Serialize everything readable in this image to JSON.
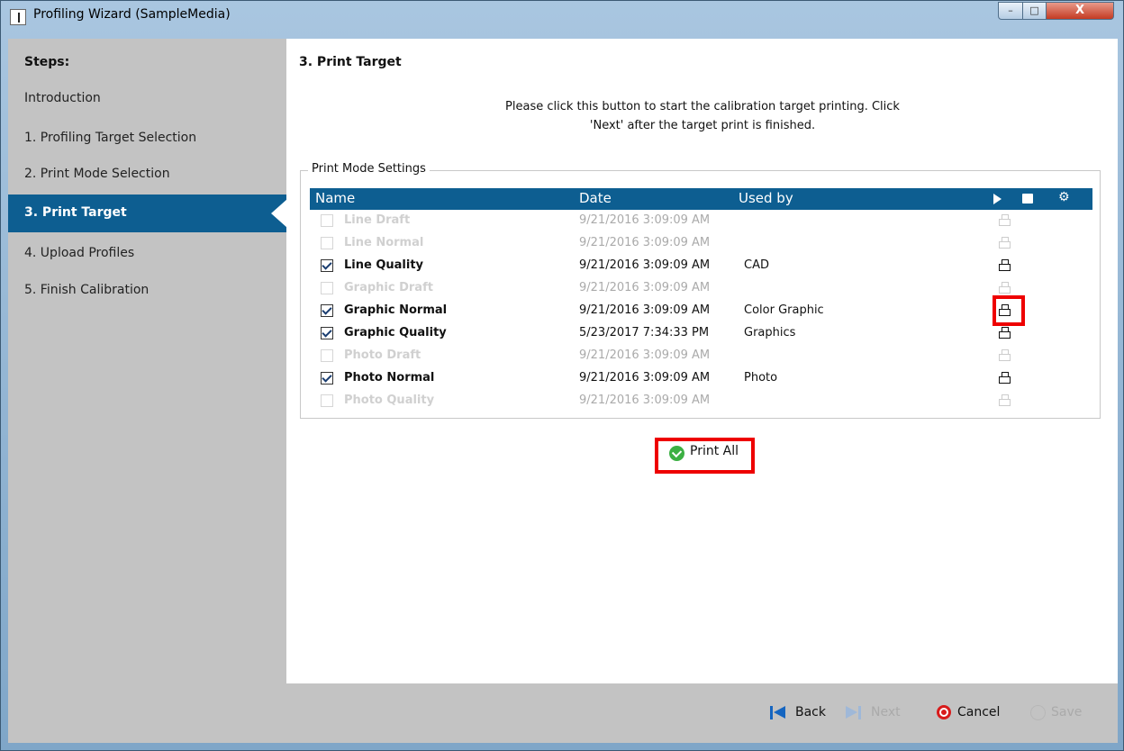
{
  "window": {
    "title": "Profiling Wizard (SampleMedia)",
    "buttons": {
      "minimize": "–",
      "maximize": "□",
      "close": "X"
    }
  },
  "sidebar": {
    "heading": "Steps:",
    "items": [
      {
        "label": "Introduction",
        "active": false
      },
      {
        "label": "1. Profiling Target Selection",
        "active": false
      },
      {
        "label": "2. Print Mode Selection",
        "active": false
      },
      {
        "label": "3. Print Target",
        "active": true
      },
      {
        "label": "4. Upload Profiles",
        "active": false
      },
      {
        "label": "5. Finish Calibration",
        "active": false
      }
    ]
  },
  "main": {
    "title": "3. Print Target",
    "instructions": "Please click this button to start the calibration target printing. Click 'Next' after the target print is finished.",
    "group_label": "Print Mode Settings",
    "columns": [
      "Name",
      "Date",
      "Used by"
    ],
    "header_icons": [
      "play-icon",
      "printer-icon",
      "settings-icon"
    ],
    "rows": [
      {
        "name": "Line Draft",
        "date": "9/21/2016 3:09:09 AM",
        "used_by": "",
        "checked": false,
        "enabled": false
      },
      {
        "name": "Line Normal",
        "date": "9/21/2016 3:09:09 AM",
        "used_by": "",
        "checked": false,
        "enabled": false
      },
      {
        "name": "Line Quality",
        "date": "9/21/2016 3:09:09 AM",
        "used_by": "CAD",
        "checked": true,
        "enabled": true
      },
      {
        "name": "Graphic Draft",
        "date": "9/21/2016 3:09:09 AM",
        "used_by": "",
        "checked": false,
        "enabled": false
      },
      {
        "name": "Graphic Normal",
        "date": "9/21/2016 3:09:09 AM",
        "used_by": "Color Graphic",
        "checked": true,
        "enabled": true
      },
      {
        "name": "Graphic Quality",
        "date": "5/23/2017 7:34:33 PM",
        "used_by": "Graphics",
        "checked": true,
        "enabled": true
      },
      {
        "name": "Photo Draft",
        "date": "9/21/2016 3:09:09 AM",
        "used_by": "",
        "checked": false,
        "enabled": false
      },
      {
        "name": "Photo Normal",
        "date": "9/21/2016 3:09:09 AM",
        "used_by": "Photo",
        "checked": true,
        "enabled": true
      },
      {
        "name": "Photo Quality",
        "date": "9/21/2016 3:09:09 AM",
        "used_by": "",
        "checked": false,
        "enabled": false
      }
    ],
    "print_all_label": "Print All"
  },
  "footer": {
    "back": "Back",
    "next": "Next",
    "cancel": "Cancel",
    "save": "Save"
  },
  "colors": {
    "accent": "#0d5e91",
    "highlight": "#ee0000",
    "panel": "#c3c3c3"
  }
}
